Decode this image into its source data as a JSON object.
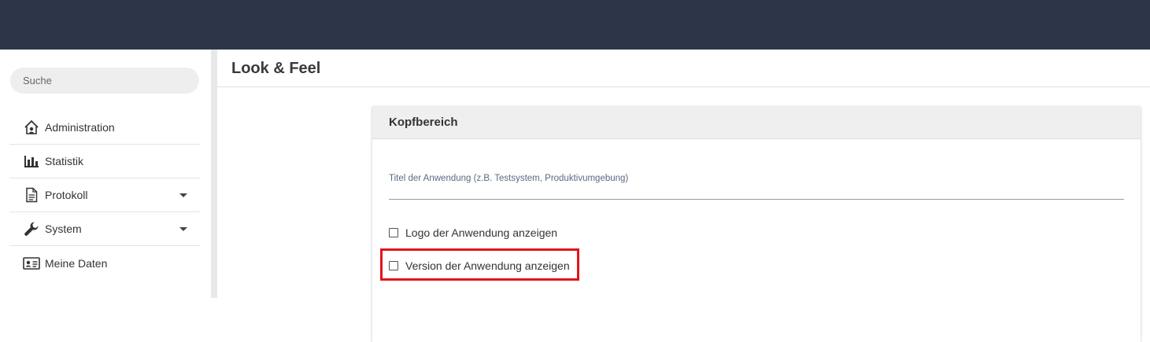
{
  "search": {
    "placeholder": "Suche"
  },
  "sidebar": {
    "items": [
      {
        "label": "Administration",
        "icon": "admin-house-icon",
        "has_submenu": false
      },
      {
        "label": "Statistik",
        "icon": "bar-chart-icon",
        "has_submenu": false
      },
      {
        "label": "Protokoll",
        "icon": "document-icon",
        "has_submenu": true
      },
      {
        "label": "System",
        "icon": "wrench-icon",
        "has_submenu": true
      },
      {
        "label": "Meine Daten",
        "icon": "id-card-icon",
        "has_submenu": false
      }
    ]
  },
  "main": {
    "page_title": "Look & Feel",
    "card": {
      "title": "Kopfbereich",
      "app_title_field": {
        "label": "Titel der Anwendung (z.B. Testsystem, Produktivumgebung)",
        "value": ""
      },
      "show_logo": {
        "label": "Logo der Anwendung anzeigen",
        "checked": false
      },
      "show_version": {
        "label": "Version der Anwendung anzeigen",
        "checked": false,
        "highlighted": true
      }
    }
  },
  "colors": {
    "topbar": "#2d3648",
    "highlight": "#e3131b",
    "card_header": "#efefef"
  }
}
